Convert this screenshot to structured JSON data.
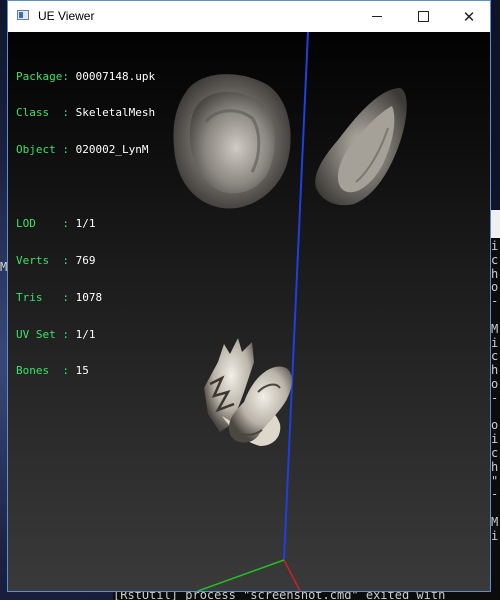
{
  "window": {
    "title": "UE Viewer",
    "buttons": {
      "minimize": "minimize",
      "maximize": "maximize",
      "close": "✕"
    }
  },
  "info": {
    "package_label": "Package:",
    "package_value": "00007148.upk",
    "class_label": "Class  :",
    "class_value": "SkeletalMesh",
    "object_label": "Object :",
    "object_value": "020002_LynM",
    "lod_label": "LOD    :",
    "lod_value": "1/1",
    "verts_label": "Verts  :",
    "verts_value": "769",
    "tris_label": "Tris   :",
    "tris_value": "1078",
    "uvset_label": "UV Set :",
    "uvset_value": "1/1",
    "bones_label": "Bones  :",
    "bones_value": "15"
  },
  "desktop": {
    "left_glyph": "M"
  },
  "console": {
    "lines": "i\nc\nh\no\n-\n\nM\ni\nc\nh\no\n-\n\no\ni\nc\nh\n\"\n-\n\nM\ni",
    "bottom_text": "[RstUtil] process \"screenshot.cmd\" exited with"
  },
  "colors": {
    "info_text": "#39e26a",
    "axis_y": "#1f3fe0",
    "axis_x": "#d02020",
    "axis_z": "#20c020"
  }
}
